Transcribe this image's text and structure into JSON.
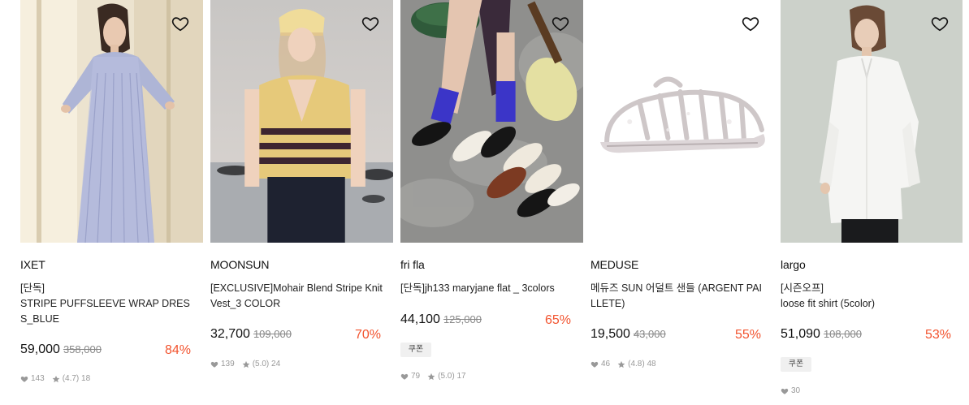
{
  "products": [
    {
      "brand": "IXET",
      "tag": "[단독]",
      "name": "STRIPE PUFFSLEEVE WRAP DRESS_BLUE",
      "price": "59,000",
      "original_price": "358,000",
      "discount": "84%",
      "coupon": null,
      "likes": "143",
      "rating": "(4.7)",
      "reviews": "18",
      "image_icon": "striped-dress-photo"
    },
    {
      "brand": "MOONSUN",
      "tag": "",
      "name": "[EXCLUSIVE]Mohair Blend Stripe Knit Vest_3 COLOR",
      "price": "32,700",
      "original_price": "109,000",
      "discount": "70%",
      "coupon": null,
      "likes": "139",
      "rating": "(5.0)",
      "reviews": "24",
      "image_icon": "knit-vest-photo"
    },
    {
      "brand": "fri fla",
      "tag": "",
      "name": "[단독]jh133 maryjane flat _ 3colors",
      "price": "44,100",
      "original_price": "125,000",
      "discount": "65%",
      "coupon": "쿠폰",
      "likes": "79",
      "rating": "(5.0)",
      "reviews": "17",
      "image_icon": "maryjane-shoes-photo"
    },
    {
      "brand": "MEDUSE",
      "tag": "",
      "name": "메듀즈 SUN 어덜트 샌들 (ARGENT PAILLETE)",
      "price": "19,500",
      "original_price": "43,000",
      "discount": "55%",
      "coupon": null,
      "likes": "46",
      "rating": "(4.8)",
      "reviews": "48",
      "image_icon": "jelly-sandal-photo"
    },
    {
      "brand": "largo",
      "tag": "[시즌오프]",
      "name": "loose fit shirt (5color)",
      "price": "51,090",
      "original_price": "108,000",
      "discount": "53%",
      "coupon": "쿠폰",
      "likes": "30",
      "rating": "",
      "reviews": "",
      "image_icon": "white-shirt-photo"
    }
  ],
  "colors": {
    "discount": "#f2532e",
    "text": "#111111",
    "muted": "#999999",
    "coupon_bg": "#f0f0f0"
  }
}
